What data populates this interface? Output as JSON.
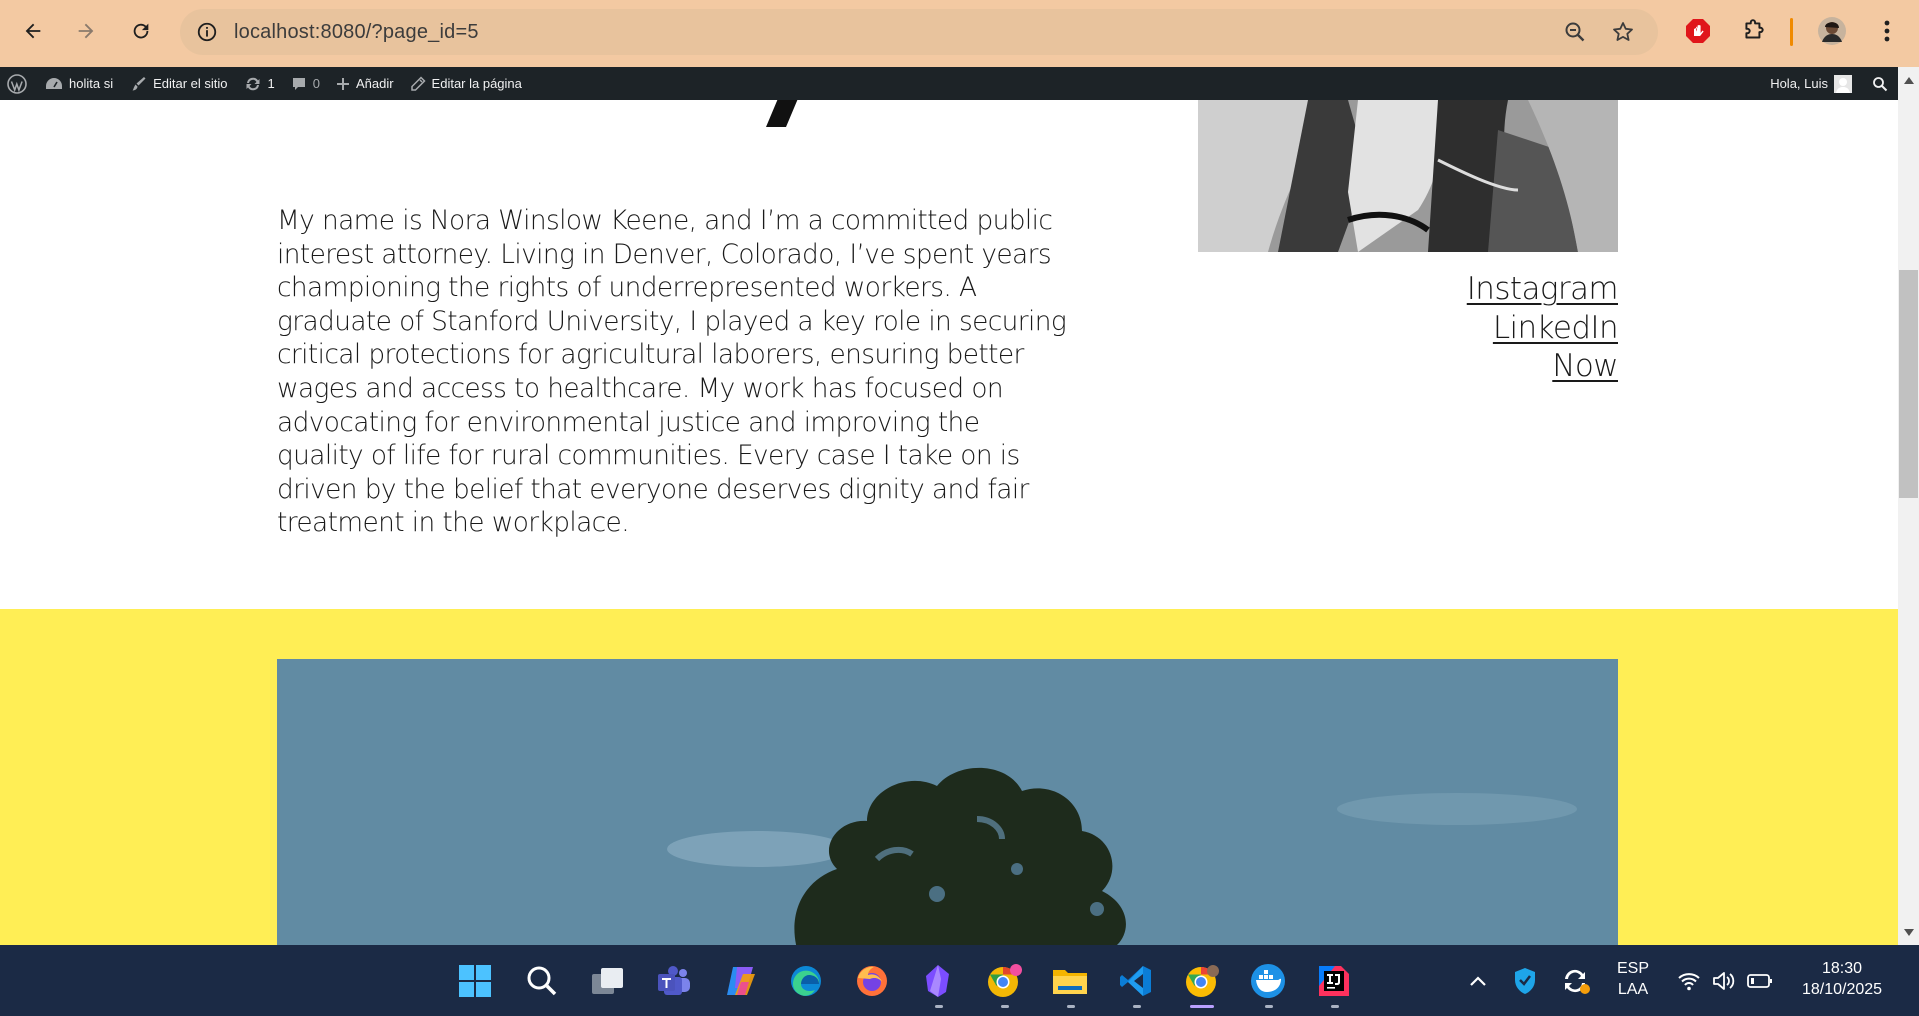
{
  "browser": {
    "url": "localhost:8080/?page_id=5",
    "icons": [
      "back-icon",
      "forward-icon",
      "reload-icon",
      "site-info-icon",
      "zoom-icon",
      "bookmark-star-icon",
      "adblock-icon",
      "extensions-icon",
      "profile-avatar",
      "menu-icon"
    ]
  },
  "wp_admin_bar": {
    "site_name": "holita si",
    "edit_site": "Editar el sitio",
    "updates_count": "1",
    "comments_count": "0",
    "add_new": "Añadir",
    "edit_page": "Editar la página",
    "greeting": "Hola, Luis"
  },
  "page": {
    "bio": "My name is Nora Winslow Keene, and I’m a committed public interest attorney. Living in Denver, Colorado, I’ve spent years championing the rights of underrepresented workers. A graduate of Stanford University, I played a key role in securing critical protections for agricultural laborers, ensuring better wages and access to healthcare. My work has focused on advocating for environmental justice and improving the quality of life for rural communities. Every case I take on is driven by the belief that everyone deserves dignity and fair treatment in the workplace.",
    "social_links": [
      "Instagram",
      "LinkedIn",
      "Now"
    ],
    "colors": {
      "yellow_band": "#ffee55",
      "text": "#1a1a1a"
    }
  },
  "taskbar": {
    "apps": [
      "start-icon",
      "search-icon",
      "task-view-icon",
      "teams-icon",
      "copilot-icon",
      "edge-icon",
      "firefox-icon",
      "obsidian-icon",
      "chrome-canary-icon",
      "file-explorer-icon",
      "vscode-icon",
      "chrome-icon",
      "docker-icon",
      "intellij-icon"
    ],
    "language": "ESP",
    "layout": "LAA",
    "time": "18:30",
    "date": "18/10/2025"
  }
}
